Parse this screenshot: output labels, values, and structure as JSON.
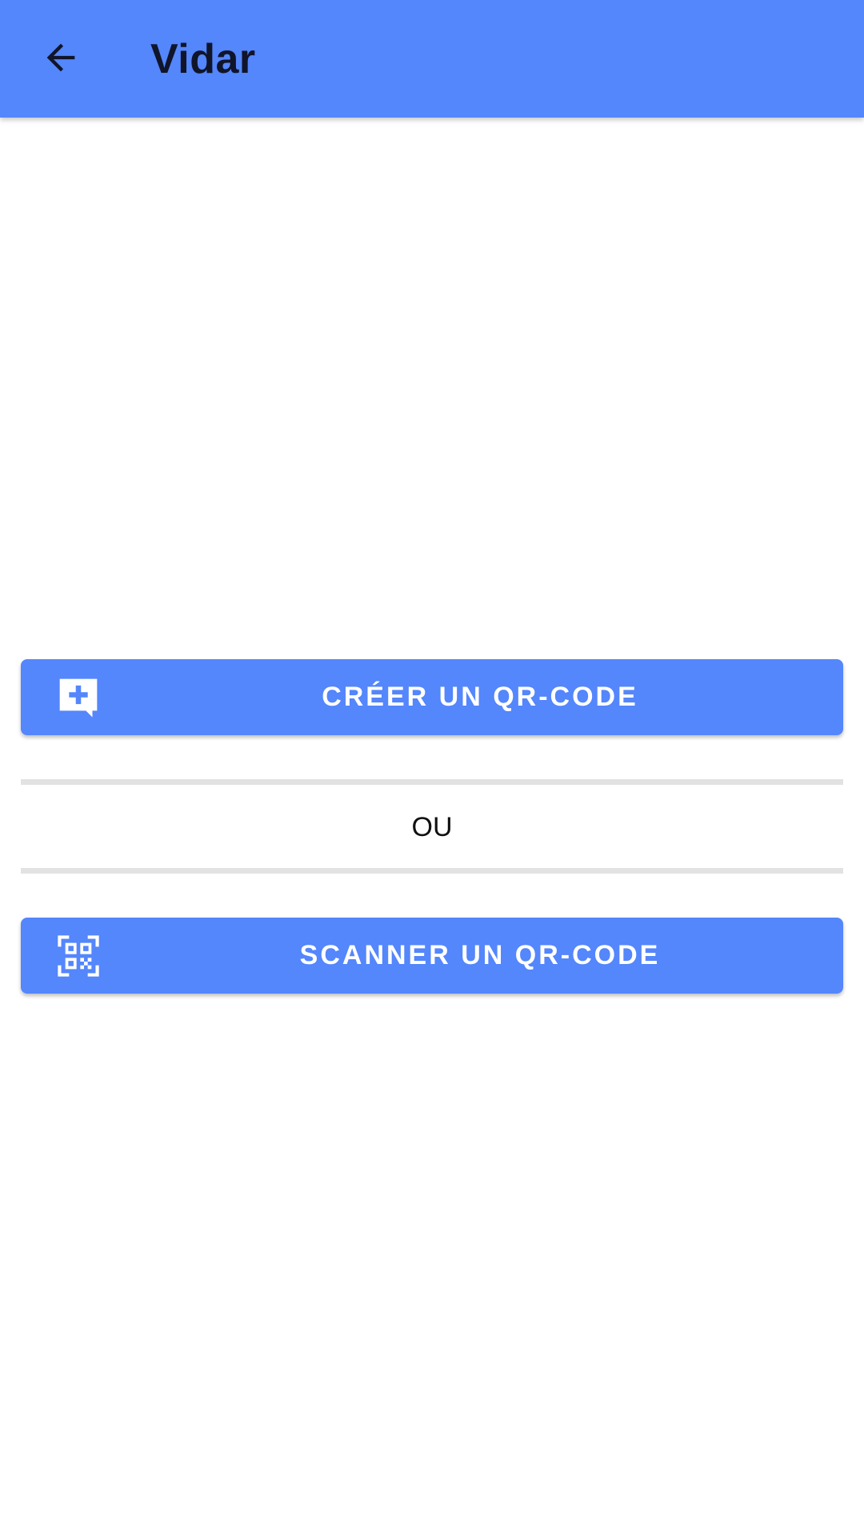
{
  "header": {
    "title": "Vidar",
    "back_icon": "arrow-back-icon"
  },
  "actions": {
    "create": {
      "label": "CRÉER UN QR-CODE",
      "icon": "add-comment-icon"
    },
    "separator_text": "OU",
    "scan": {
      "label": "SCANNER UN QR-CODE",
      "icon": "qr-code-scanner-icon"
    }
  },
  "colors": {
    "primary": "#5486fc",
    "title_text": "#10152a",
    "button_text": "#ffffff",
    "divider": "#e2e2e2"
  }
}
